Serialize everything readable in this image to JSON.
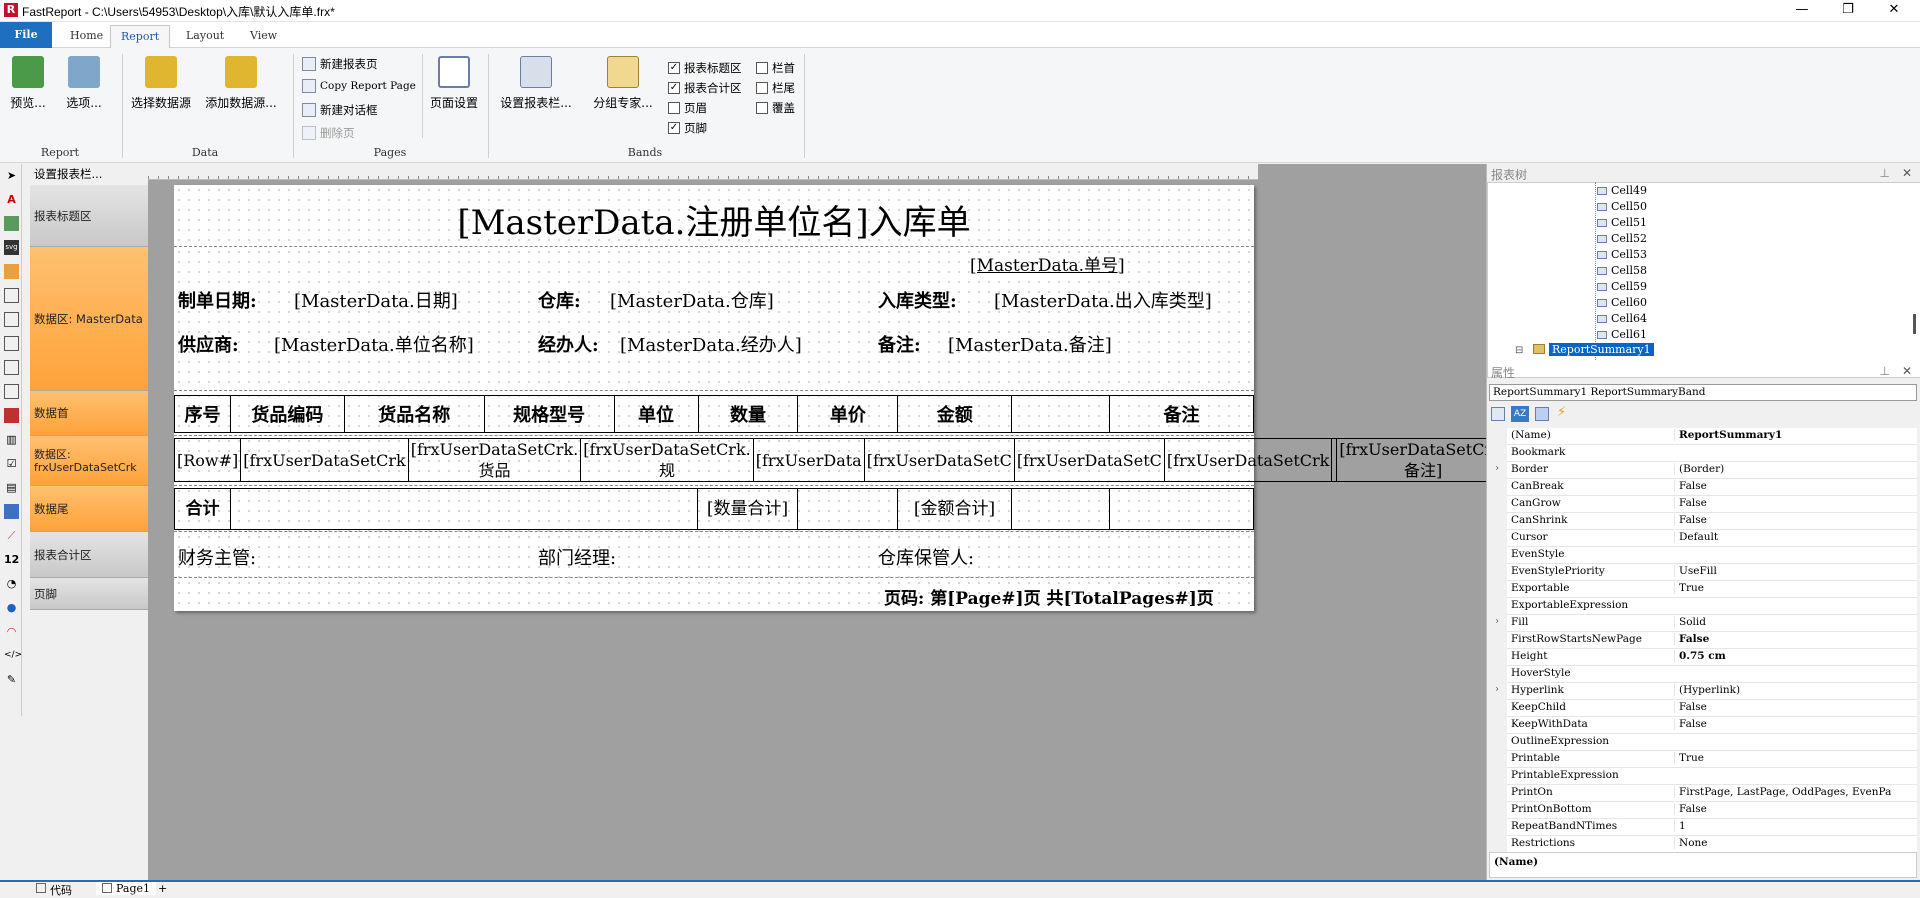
{
  "window": {
    "title": "FastReport - C:\\Users\\54953\\Desktop\\入库\\默认入库单.frx*",
    "app_icon": "R",
    "minimize": "—",
    "maximize": "❐",
    "close": "✕"
  },
  "menu_tabs": [
    "File",
    "Home",
    "Report",
    "Layout",
    "View"
  ],
  "ribbon": {
    "report_group": {
      "label": "Report",
      "preview": "预览...",
      "options": "选项..."
    },
    "data_group": {
      "label": "Data",
      "select_source": "选择数据源",
      "add_source": "添加数据源..."
    },
    "pages_group": {
      "label": "Pages",
      "new_page": "新建报表页",
      "copy_page": "Copy Report Page",
      "new_dialog": "新建对话框",
      "delete_page": "删除页",
      "page_setup": "页面设置"
    },
    "bands_group": {
      "label": "Bands",
      "setup_bands": "设置报表栏...",
      "group_expert": "分组专家..."
    },
    "checks": [
      {
        "label": "报表标题区",
        "checked": true
      },
      {
        "label": "报表合计区",
        "checked": true
      },
      {
        "label": "页眉",
        "checked": false
      },
      {
        "label": "页脚",
        "checked": true
      },
      {
        "label": "栏首",
        "checked": false
      },
      {
        "label": "栏尾",
        "checked": false
      },
      {
        "label": "覆盖",
        "checked": false
      }
    ]
  },
  "band_panel": {
    "header": "设置报表栏...",
    "bands": [
      "报表标题区",
      "数据区: MasterData",
      "数据首",
      "数据区: frxUserDataSetCrk",
      "数据尾",
      "报表合计区",
      "页脚"
    ]
  },
  "report": {
    "title": "[MasterData.注册单位名]入库单",
    "doc_no": "[MasterData.单号]",
    "labels": {
      "date": "制单日期:",
      "date_val": "[MasterData.日期]",
      "warehouse": "仓库:",
      "warehouse_val": "[MasterData.仓库]",
      "type": "入库类型:",
      "type_val": "[MasterData.出入库类型]",
      "supplier": "供应商:",
      "supplier_val": "[MasterData.单位名称]",
      "handler": "经办人:",
      "handler_val": "[MasterData.经办人]",
      "remark": "备注:",
      "remark_val": "[MasterData.备注]"
    },
    "header_cells": [
      "序号",
      "货品编码",
      "货品名称",
      "规格型号",
      "单位",
      "数量",
      "单价",
      "金额",
      "",
      "备注"
    ],
    "data_cells": [
      "[Row#]",
      "[frxUserDataSetCrk",
      "[frxUserDataSetCrk.货品",
      "[frxUserDataSetCrk.规",
      "[frxUserData",
      "[frxUserDataSetC",
      "[frxUserDataSetC",
      "[frxUserDataSetCrk",
      "",
      "[frxUserDataSetCrk.备注]"
    ],
    "footer_cells": [
      "合计",
      "",
      "",
      "",
      "",
      "[数量合计]",
      "",
      "[金额合计]",
      "",
      ""
    ],
    "summary": {
      "finance": "财务主管:",
      "manager": "部门经理:",
      "keeper": "仓库保管人:"
    },
    "page_footer": "页码: 第[Page#]页 共[TotalPages#]页"
  },
  "report_tree": {
    "title": "报表树",
    "items": [
      "Cell49",
      "Cell50",
      "Cell51",
      "Cell52",
      "Cell53",
      "Cell58",
      "Cell59",
      "Cell60",
      "Cell64",
      "Cell61"
    ],
    "selected": "ReportSummary1"
  },
  "properties": {
    "title": "属性",
    "object": "ReportSummary1 ReportSummaryBand",
    "rows": [
      {
        "name": "(Name)",
        "value": "ReportSummary1",
        "bold": true
      },
      {
        "name": "Bookmark",
        "value": ""
      },
      {
        "name": "Border",
        "value": "(Border)",
        "expand": true
      },
      {
        "name": "CanBreak",
        "value": "False"
      },
      {
        "name": "CanGrow",
        "value": "False"
      },
      {
        "name": "CanShrink",
        "value": "False"
      },
      {
        "name": "Cursor",
        "value": "Default"
      },
      {
        "name": "EvenStyle",
        "value": ""
      },
      {
        "name": "EvenStylePriority",
        "value": "UseFill"
      },
      {
        "name": "Exportable",
        "value": "True"
      },
      {
        "name": "ExportableExpression",
        "value": ""
      },
      {
        "name": "Fill",
        "value": "Solid",
        "expand": true
      },
      {
        "name": "FirstRowStartsNewPage",
        "value": "False",
        "bold": true
      },
      {
        "name": "Height",
        "value": "0.75 cm",
        "bold": true
      },
      {
        "name": "HoverStyle",
        "value": ""
      },
      {
        "name": "Hyperlink",
        "value": "(Hyperlink)",
        "expand": true
      },
      {
        "name": "KeepChild",
        "value": "False"
      },
      {
        "name": "KeepWithData",
        "value": "False"
      },
      {
        "name": "OutlineExpression",
        "value": ""
      },
      {
        "name": "Printable",
        "value": "True"
      },
      {
        "name": "PrintableExpression",
        "value": ""
      },
      {
        "name": "PrintOn",
        "value": "FirstPage, LastPage, OddPages, EvenPa"
      },
      {
        "name": "PrintOnBottom",
        "value": "False"
      },
      {
        "name": "RepeatBandNTimes",
        "value": "1"
      },
      {
        "name": "Restrictions",
        "value": "None"
      }
    ],
    "description": "(Name)"
  },
  "status_tabs": [
    "代码",
    "Page1",
    "+"
  ],
  "colors": {
    "accent": "#1e6fbf",
    "band_active": "#ffa23a",
    "band_inactive": "#d8d8d8"
  }
}
